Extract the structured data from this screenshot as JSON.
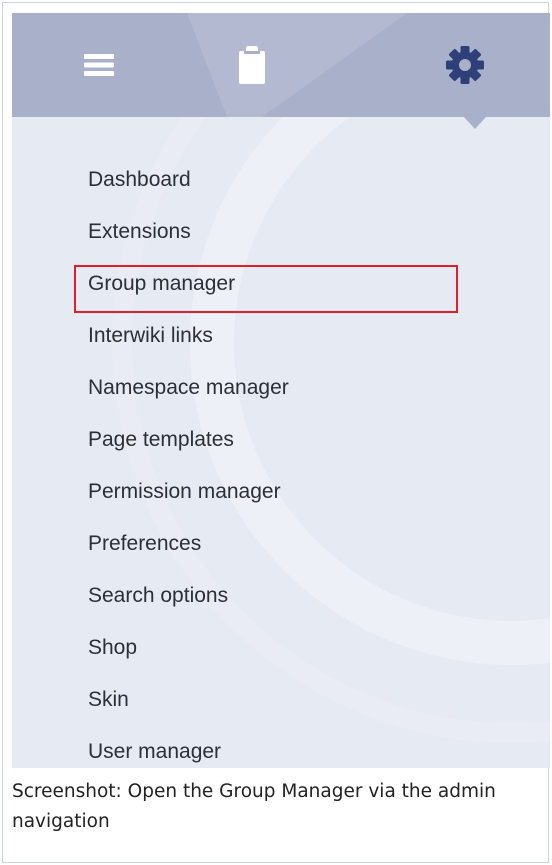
{
  "topbar": {
    "tabs": [
      {
        "icon": "hamburger-menu-icon"
      },
      {
        "icon": "clipboard-icon"
      },
      {
        "icon": "gear-icon",
        "active": true
      }
    ],
    "colors": {
      "bar": "#a9b0c9",
      "icon": "#ffffff",
      "active_icon": "#2f3f77"
    }
  },
  "admin_nav": {
    "items": [
      {
        "label": "Dashboard"
      },
      {
        "label": "Extensions"
      },
      {
        "label": "Group manager",
        "highlighted": true
      },
      {
        "label": "Interwiki links"
      },
      {
        "label": "Namespace manager"
      },
      {
        "label": "Page templates"
      },
      {
        "label": "Permission manager"
      },
      {
        "label": "Preferences"
      },
      {
        "label": "Search options"
      },
      {
        "label": "Shop"
      },
      {
        "label": "Skin"
      },
      {
        "label": "User manager"
      }
    ],
    "highlight_color": "#e01f2a"
  },
  "caption": {
    "text": "Screenshot: Open the Group Manager via the admin navigation"
  }
}
